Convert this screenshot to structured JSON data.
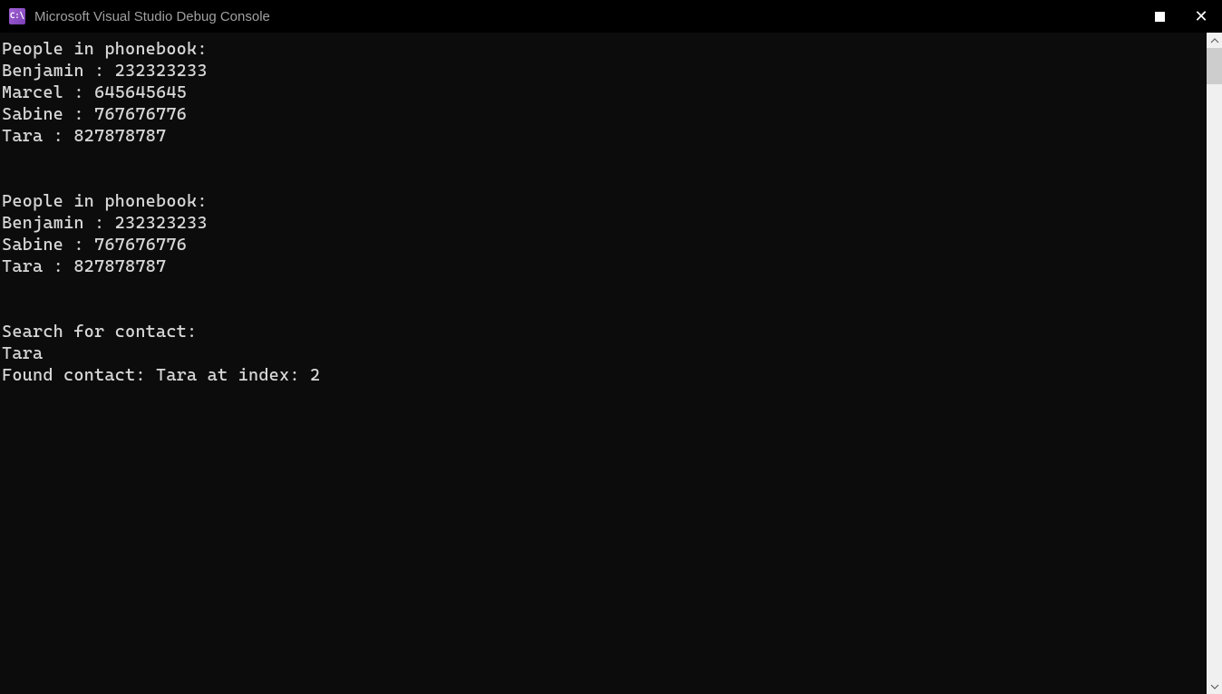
{
  "window": {
    "title": "Microsoft Visual Studio Debug Console",
    "icon_label": "C:\\"
  },
  "console": {
    "lines": [
      "People in phonebook:",
      "Benjamin : 232323233",
      "Marcel : 645645645",
      "Sabine : 767676776",
      "Tara : 827878787",
      "",
      "",
      "People in phonebook:",
      "Benjamin : 232323233",
      "Sabine : 767676776",
      "Tara : 827878787",
      "",
      "",
      "Search for contact:",
      "Tara",
      "Found contact: Tara at index: 2"
    ]
  }
}
